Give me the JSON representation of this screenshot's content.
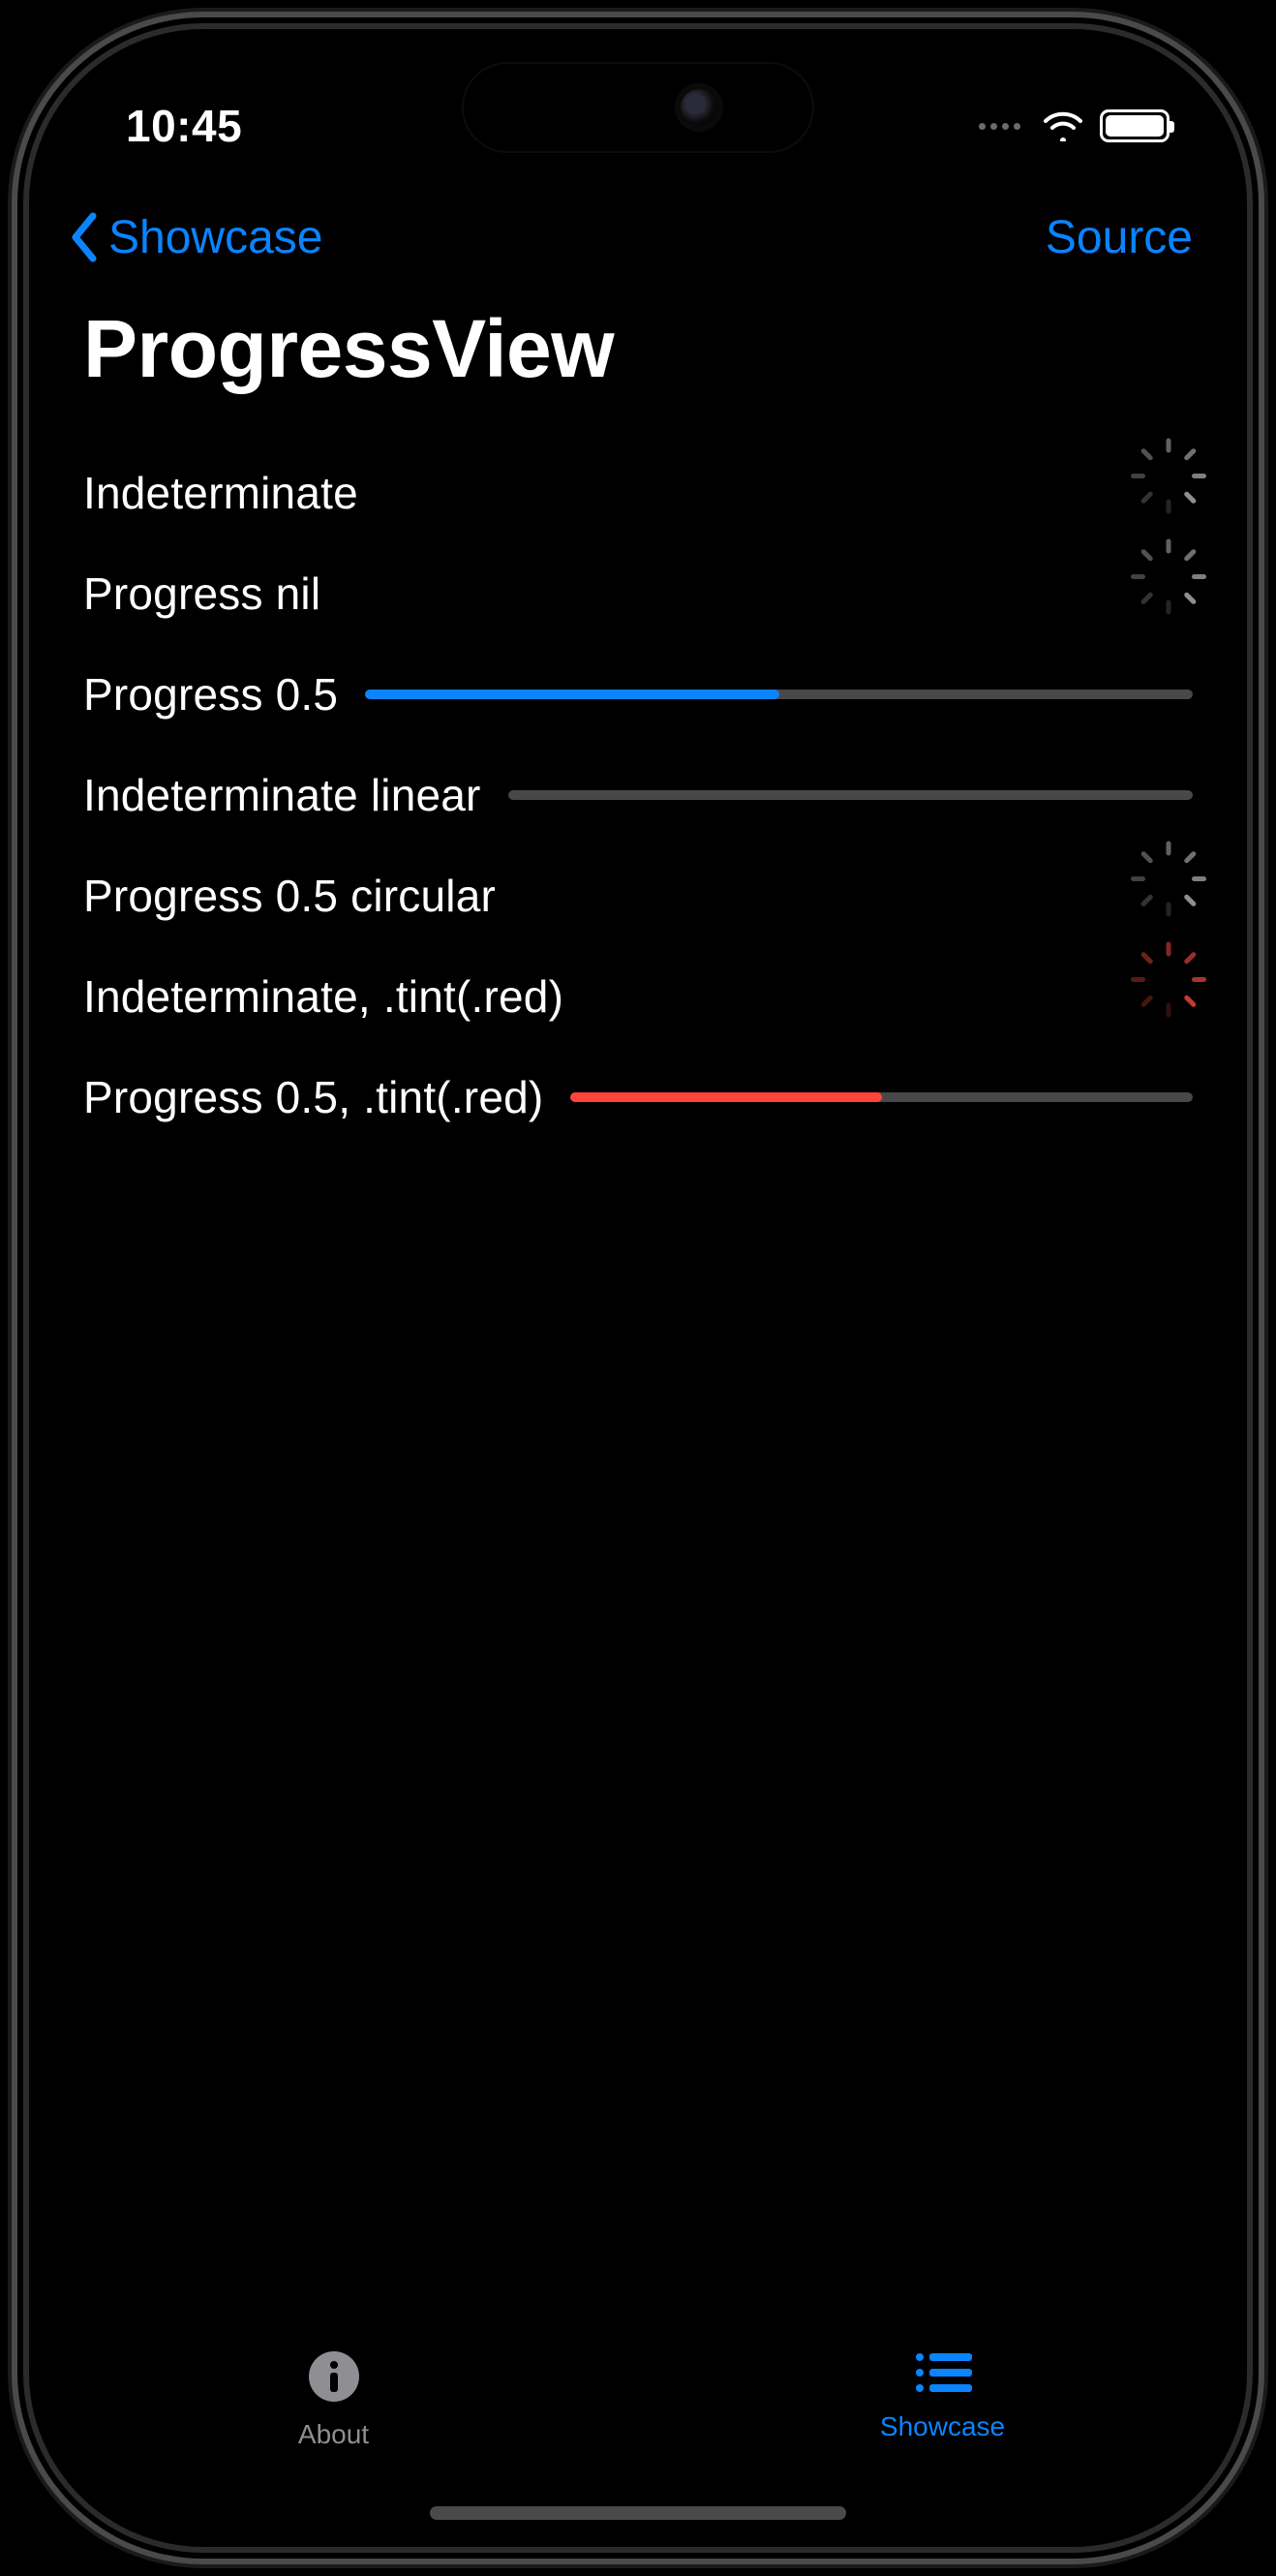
{
  "status": {
    "time": "10:45"
  },
  "nav": {
    "back_label": "Showcase",
    "action_label": "Source"
  },
  "title": "ProgressView",
  "rows": [
    {
      "label": "Indeterminate",
      "type": "spinner",
      "tint": "#8e8e93"
    },
    {
      "label": "Progress nil",
      "type": "spinner",
      "tint": "#8e8e93"
    },
    {
      "label": "Progress 0.5",
      "type": "linear",
      "value": 0.5,
      "tint": "#0a84ff"
    },
    {
      "label": "Indeterminate linear",
      "type": "linear",
      "value": 0,
      "tint": "#48484a"
    },
    {
      "label": "Progress 0.5 circular",
      "type": "spinner",
      "tint": "#8e8e93"
    },
    {
      "label": "Indeterminate, .tint(.red)",
      "type": "spinner",
      "tint": "#bf3b30"
    },
    {
      "label": "Progress 0.5, .tint(.red)",
      "type": "linear",
      "value": 0.5,
      "tint": "#ff453a"
    }
  ],
  "tabs": {
    "about_label": "About",
    "showcase_label": "Showcase"
  },
  "colors": {
    "accent": "#0a84ff",
    "red": "#ff453a",
    "gray": "#8e8e93",
    "track": "#48484a"
  }
}
